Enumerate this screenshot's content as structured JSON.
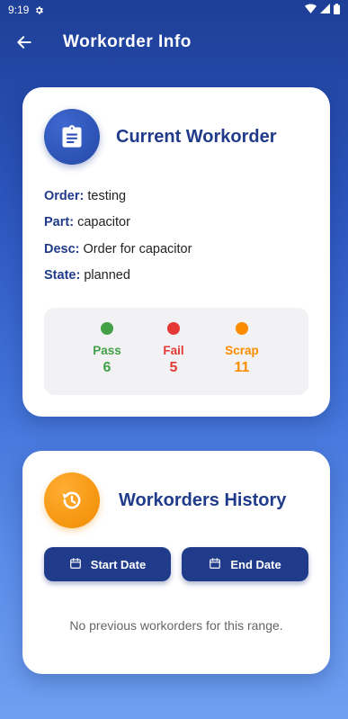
{
  "status": {
    "time": "9:19"
  },
  "appbar": {
    "title": "Workorder Info"
  },
  "current": {
    "title": "Current Workorder",
    "fields": [
      {
        "key": "Order:",
        "value": "testing"
      },
      {
        "key": "Part:",
        "value": "capacitor"
      },
      {
        "key": "Desc:",
        "value": "Order for capacitor"
      },
      {
        "key": "State:",
        "value": "planned"
      }
    ],
    "stats": {
      "pass": {
        "label": "Pass",
        "value": "6",
        "color": "#43a047"
      },
      "fail": {
        "label": "Fail",
        "value": "5",
        "color": "#e53935"
      },
      "scrap": {
        "label": "Scrap",
        "value": "11",
        "color": "#fb8c00"
      }
    }
  },
  "history": {
    "title": "Workorders History",
    "start_label": "Start Date",
    "end_label": "End Date",
    "empty_text": "No previous workorders for this range."
  },
  "colors": {
    "primary": "#1f3b8a",
    "accent_orange": "#f59a0f"
  }
}
